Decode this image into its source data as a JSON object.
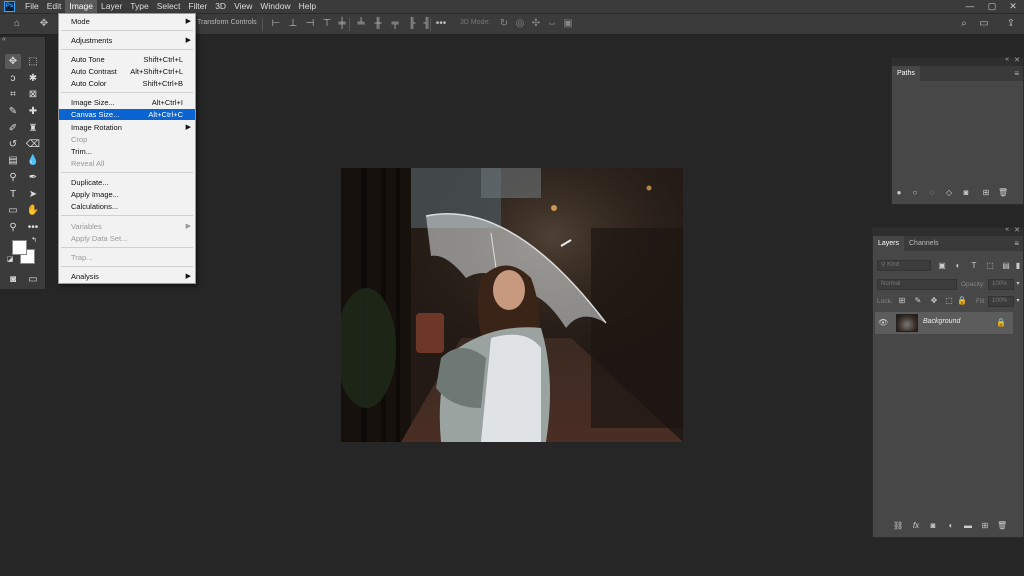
{
  "menubar": {
    "logo": "Ps",
    "items": [
      "File",
      "Edit",
      "Image",
      "Layer",
      "Type",
      "Select",
      "Filter",
      "3D",
      "View",
      "Window",
      "Help"
    ],
    "active_index": 2,
    "window_controls": [
      "—",
      "▢",
      "✕"
    ]
  },
  "options": {
    "transform_controls": "Transform Controls",
    "mode_3d": "3D Mode:"
  },
  "image_menu": {
    "items": [
      {
        "label": "Mode",
        "submenu": true
      },
      {
        "label": "Adjustments",
        "submenu": true
      },
      {
        "label": "Auto Tone",
        "shortcut": "Shift+Ctrl+L"
      },
      {
        "label": "Auto Contrast",
        "shortcut": "Alt+Shift+Ctrl+L"
      },
      {
        "label": "Auto Color",
        "shortcut": "Shift+Ctrl+B"
      },
      {
        "label": "Image Size...",
        "shortcut": "Alt+Ctrl+I"
      },
      {
        "label": "Canvas Size...",
        "shortcut": "Alt+Ctrl+C",
        "highlighted": true
      },
      {
        "label": "Image Rotation",
        "submenu": true
      },
      {
        "label": "Crop",
        "disabled": true
      },
      {
        "label": "Trim..."
      },
      {
        "label": "Reveal All",
        "disabled": true
      },
      {
        "label": "Duplicate..."
      },
      {
        "label": "Apply Image..."
      },
      {
        "label": "Calculations..."
      },
      {
        "label": "Variables",
        "disabled": true,
        "submenu": true
      },
      {
        "label": "Apply Data Set...",
        "disabled": true
      },
      {
        "label": "Trap...",
        "disabled": true
      },
      {
        "label": "Analysis",
        "submenu": true
      }
    ]
  },
  "paths_panel": {
    "tab": "Paths"
  },
  "layers_panel": {
    "tabs": [
      "Layers",
      "Channels"
    ],
    "active_tab": "Layers",
    "filter_placeholder": "Kind",
    "blend_mode": "Normal",
    "opacity_label": "Opacity:",
    "opacity_value": "100%",
    "lock_label": "Lock:",
    "fill_label": "Fill:",
    "fill_value": "100%",
    "layers": [
      {
        "name": "Background",
        "visible": true,
        "locked": true
      }
    ]
  },
  "colors": {
    "menu_highlight": "#0a64d2",
    "ps_blue": "#31a8ff"
  }
}
